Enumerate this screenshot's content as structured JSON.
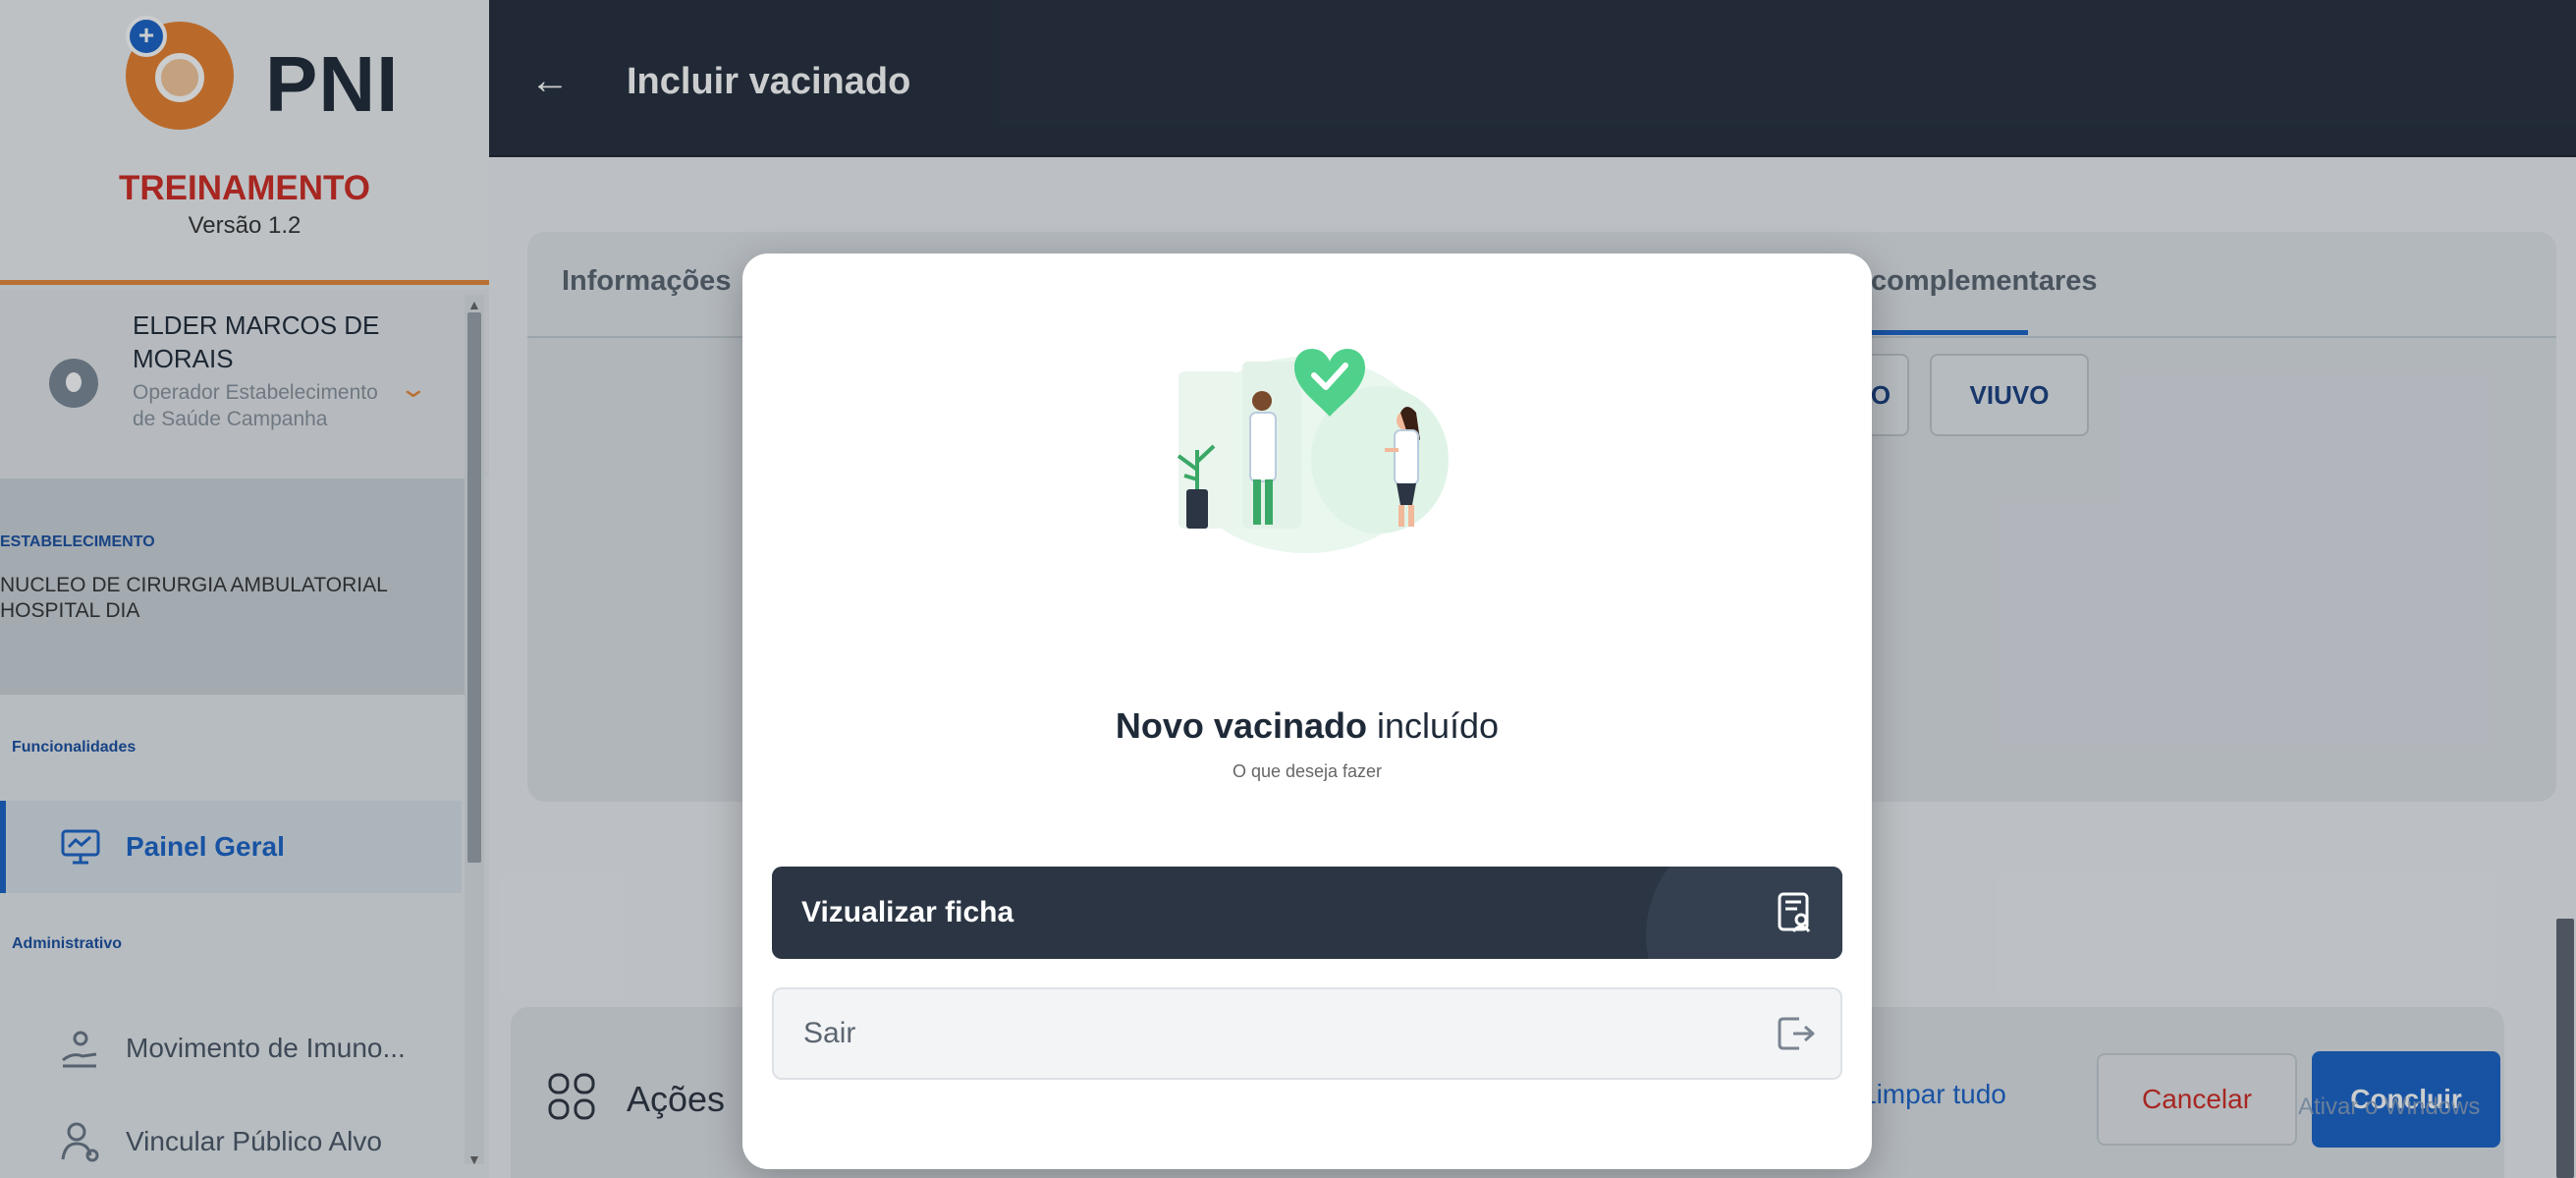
{
  "app": {
    "logo_text": "PNI",
    "environment": "TREINAMENTO",
    "version": "Versão 1.2"
  },
  "user": {
    "name": "ELDER MARCOS DE MORAIS",
    "role": "Operador Estabelecimento de Saúde Campanha"
  },
  "establishment": {
    "label": "ESTABELECIMENTO",
    "name": "NUCLEO DE CIRURGIA AMBULATORIAL HOSPITAL DIA"
  },
  "sidebar": {
    "section_func": "Funcionalidades",
    "section_admin": "Administrativo",
    "items": [
      {
        "label": "Painel Geral",
        "icon": "monitor-chart-icon"
      },
      {
        "label": "Movimento de Imuno...",
        "icon": "hand-vaccine-icon"
      },
      {
        "label": "Vincular Público Alvo",
        "icon": "user-link-icon"
      }
    ]
  },
  "header": {
    "back_icon": "←",
    "title": "Incluir vacinado"
  },
  "tabs": {
    "info": "Informações",
    "complementares": "complementares"
  },
  "chips": {
    "partial": "O",
    "viuvo": "VIUVO"
  },
  "actions": {
    "title": "Ações",
    "limpar": "Limpar tudo",
    "cancelar": "Cancelar",
    "concluir": "Concluir"
  },
  "watermark": "Ativar o Windows",
  "modal": {
    "title_main": "Novo vacinado",
    "title_rest": " incluído",
    "subtitle": "O que deseja fazer",
    "ficha_label": "Vizualizar ficha",
    "sair_label": "Sair"
  },
  "colors": {
    "primary": "#1a63c8",
    "header_bg": "#252e3b",
    "accent_orange": "#e8883a",
    "danger": "#d12a22",
    "success_green": "#4fd18b"
  }
}
